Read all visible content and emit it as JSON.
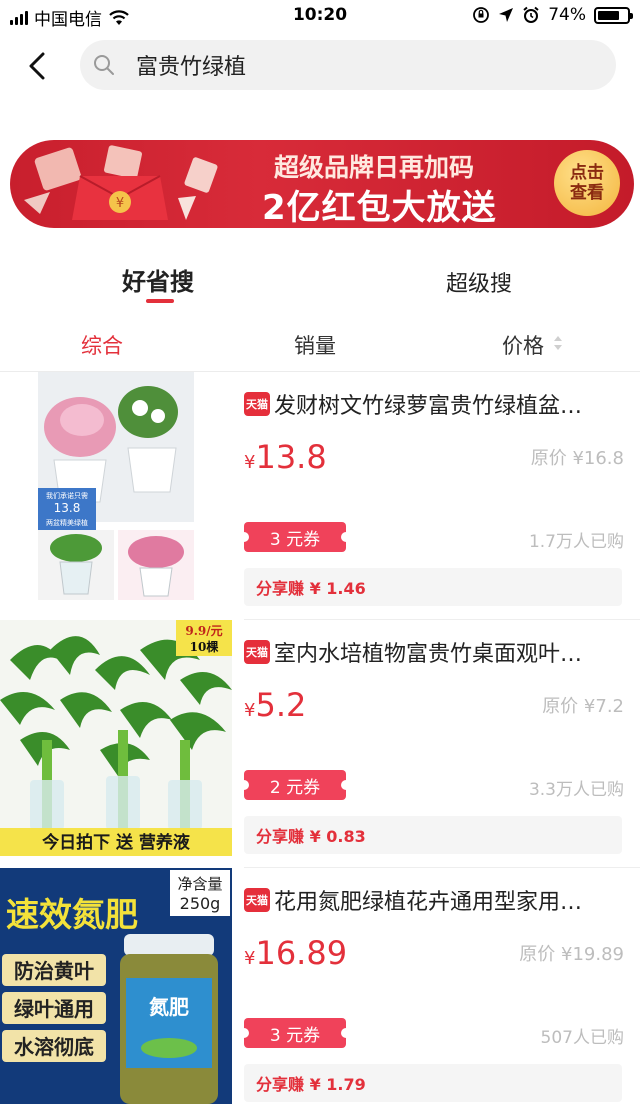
{
  "status_bar": {
    "carrier": "中国电信",
    "time": "10:20",
    "battery": "74%",
    "battery_level": 0.74
  },
  "search": {
    "query": "富贵竹绿植",
    "icon": "search-icon",
    "back_icon": "back-arrow-icon"
  },
  "banner": {
    "line1": "超级品牌日再加码",
    "line2": "2亿红包大放送",
    "button": "点击查看",
    "button_line1": "点击",
    "button_line2": "查看"
  },
  "mode_tabs": [
    {
      "label": "好省搜",
      "active": true
    },
    {
      "label": "超级搜",
      "active": false
    }
  ],
  "sort_tabs": [
    {
      "label": "综合",
      "active": true
    },
    {
      "label": "销量",
      "active": false
    },
    {
      "label": "价格",
      "active": false
    }
  ],
  "products": [
    {
      "badge": "天猫",
      "title": "发财树文竹绿萝富贵竹绿植盆…",
      "currency": "¥",
      "price": "13.8",
      "original_price": "原价 ¥16.8",
      "coupon": "3 元券",
      "sold": "1.7万人已购",
      "share": "分享赚 ¥ 1.46",
      "image_text": {
        "deal_label": "我们承诺只需",
        "deal_price": "13.8",
        "deal_caption": "两盆精美绿植"
      }
    },
    {
      "badge": "天猫",
      "title": "室内水培植物富贵竹桌面观叶…",
      "currency": "¥",
      "price": "5.2",
      "original_price": "原价 ¥7.2",
      "coupon": "2 元券",
      "sold": "3.3万人已购",
      "share": "分享赚 ¥ 0.83",
      "image_text": {
        "corner_price": "9.9/元",
        "corner_count": "10棵",
        "footer": "今日拍下 送 营养液"
      }
    },
    {
      "badge": "天猫",
      "title": "花用氮肥绿植花卉通用型家用…",
      "currency": "¥",
      "price": "16.89",
      "original_price": "原价 ¥19.89",
      "coupon": "3 元券",
      "sold": "507人已购",
      "share": "分享赚 ¥ 1.79",
      "image_text": {
        "headline": "速效氮肥",
        "net_label": "净含量",
        "net_weight": "250g",
        "tag1": "防治黄叶",
        "tag2": "绿叶通用",
        "tag3": "水溶彻底",
        "jar_label": "氮肥"
      }
    }
  ],
  "colors": {
    "accent": "#e3303b",
    "coupon": "#f0425a",
    "muted": "#bdbdbd",
    "banner_red": "#c81f2d"
  }
}
